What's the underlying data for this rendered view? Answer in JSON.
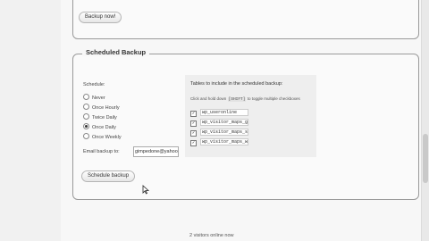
{
  "top_section": {
    "backup_now_label": "Backup now!"
  },
  "scheduled_backup": {
    "legend": "Scheduled Backup",
    "schedule_label": "Schedule:",
    "options": [
      {
        "label": "Never",
        "selected": false
      },
      {
        "label": "Once Hourly",
        "selected": false
      },
      {
        "label": "Twice Daily",
        "selected": false
      },
      {
        "label": "Once Daily",
        "selected": true
      },
      {
        "label": "Once Weekly",
        "selected": false
      }
    ],
    "email_label": "Email backup to:",
    "email_value": "gimpedone@yahoo.ca",
    "schedule_button": "Schedule backup",
    "tables_title": "Tables to include in the scheduled backup:",
    "tables_hint_pre": "Click and hold down",
    "tables_hint_key": "[SHIFT]",
    "tables_hint_post": "to toggle multiple checkboxes",
    "tables": [
      {
        "name": "wp_useronline",
        "checked": true
      },
      {
        "name": "wp_visitor_maps_ge",
        "checked": true
      },
      {
        "name": "wp_visitor_maps_st",
        "checked": true
      },
      {
        "name": "wp_visitor_maps_wo",
        "checked": true
      }
    ]
  },
  "footer": {
    "visitors_text": "2 visitors online now"
  }
}
